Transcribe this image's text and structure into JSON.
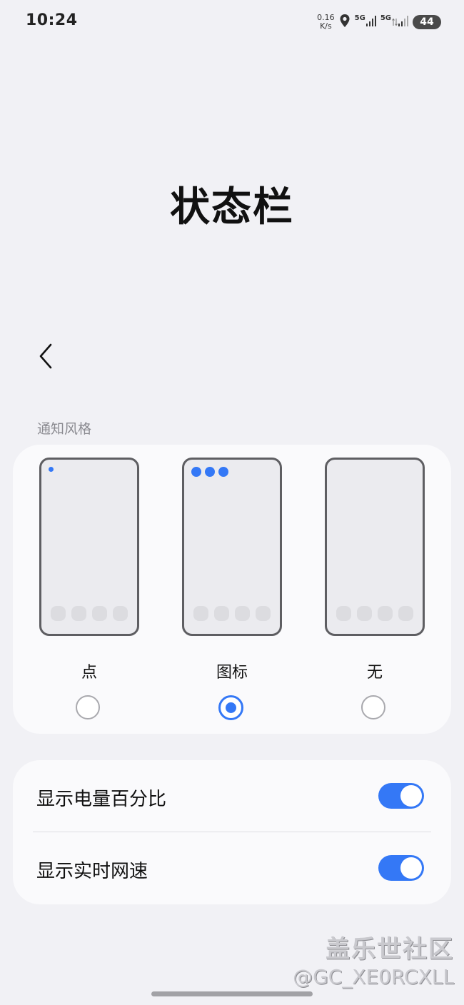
{
  "status_bar": {
    "time": "10:24",
    "net_speed_value": "0.16",
    "net_speed_unit": "K/s",
    "sim1": "5G",
    "sim2": "5G",
    "battery": "44",
    "icons": [
      "location-icon",
      "signal-icon",
      "data-arrows-icon",
      "battery-icon"
    ]
  },
  "page": {
    "title": "状态栏"
  },
  "notification_style": {
    "section_label": "通知风格",
    "options": [
      {
        "label": "点",
        "selected": false
      },
      {
        "label": "图标",
        "selected": true
      },
      {
        "label": "无",
        "selected": false
      }
    ]
  },
  "toggles": [
    {
      "label": "显示电量百分比",
      "on": true
    },
    {
      "label": "显示实时网速",
      "on": true
    }
  ],
  "watermark": {
    "brand": "盖乐世社区",
    "handle": "@GC_XE0RCXLL"
  },
  "colors": {
    "accent": "#3478f6",
    "background": "#f1f1f5",
    "card": "#fafafc"
  }
}
